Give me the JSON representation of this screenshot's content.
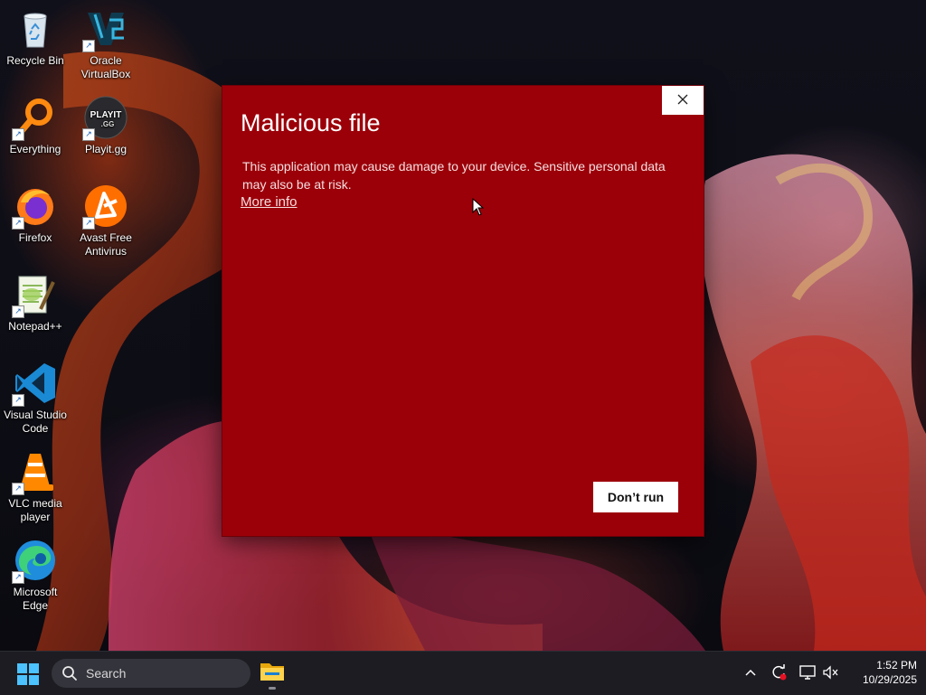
{
  "desktop": {
    "icons": [
      {
        "label": "Recycle Bin",
        "icon": "recycle-bin-icon"
      },
      {
        "label": "Oracle VirtualBox",
        "icon": "virtualbox-icon"
      },
      {
        "label": "Everything",
        "icon": "everything-icon"
      },
      {
        "label": "Playit.gg",
        "icon": "playit-icon",
        "logo_text": "PLAYIT",
        "logo_sub": ".GG"
      },
      {
        "label": "Firefox",
        "icon": "firefox-icon"
      },
      {
        "label": "Avast Free Antivirus",
        "icon": "avast-icon"
      },
      {
        "label": "Notepad++",
        "icon": "notepadpp-icon"
      },
      {
        "label": "Visual Studio Code",
        "icon": "vscode-icon"
      },
      {
        "label": "VLC media player",
        "icon": "vlc-icon"
      },
      {
        "label": "Microsoft Edge",
        "icon": "edge-icon"
      }
    ]
  },
  "dialog": {
    "title": "Malicious file",
    "message": "This application may cause damage to your device. Sensitive personal data may also be at risk.",
    "link": "More info",
    "primary_button": "Don’t run",
    "background_color": "#9b0009"
  },
  "taskbar": {
    "search_placeholder": "Search",
    "time": "1:52 PM",
    "date": "10/29/2025",
    "tray_icons": [
      "chevron-up-icon",
      "sync-icon",
      "display-icon",
      "volume-muted-icon"
    ]
  }
}
